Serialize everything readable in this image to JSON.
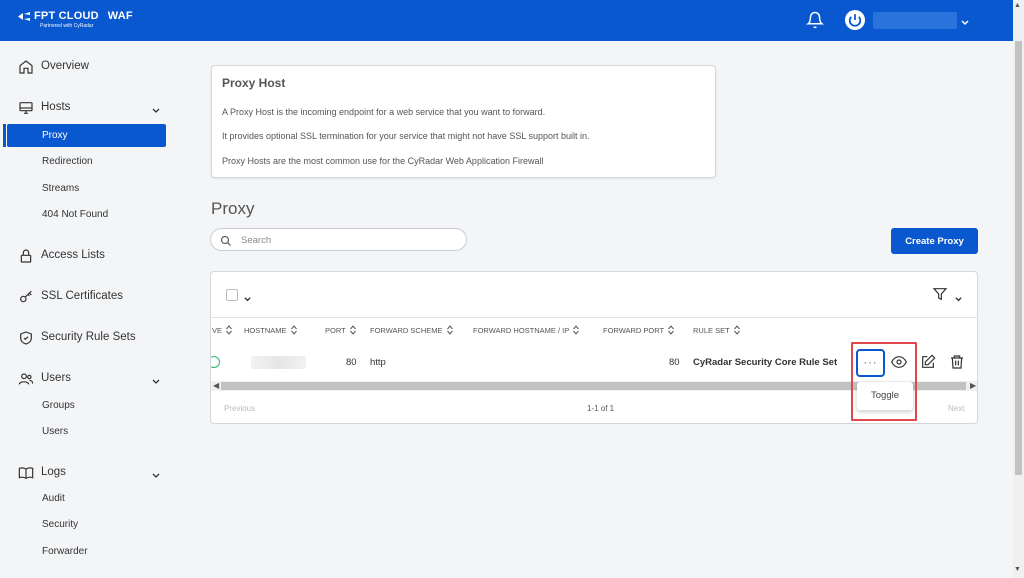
{
  "header": {
    "brand": "FPT CLOUD",
    "product": "WAF",
    "tagline": "Partnered with CyRadar"
  },
  "sidebar": {
    "groups": [
      {
        "label": "Overview",
        "icon": "home-icon"
      },
      {
        "label": "Hosts",
        "icon": "monitor-icon"
      },
      {
        "label": "Access Lists",
        "icon": "lock-icon"
      },
      {
        "label": "SSL Certificates",
        "icon": "key-icon"
      },
      {
        "label": "Security Rule Sets",
        "icon": "shield-icon"
      },
      {
        "label": "Users",
        "icon": "users-icon"
      },
      {
        "label": "Logs",
        "icon": "book-icon"
      }
    ],
    "hosts_items": [
      "Proxy",
      "Redirection",
      "Streams",
      "404 Not Found"
    ],
    "users_items": [
      "Groups",
      "Users"
    ],
    "logs_items": [
      "Audit",
      "Security",
      "Forwarder"
    ],
    "active_item": "Proxy"
  },
  "info_card": {
    "title": "Proxy Host",
    "lines": [
      "A Proxy Host is the incoming endpoint for a web service that you want to forward.",
      "It provides optional SSL termination for your service that might not have SSL support built in.",
      "Proxy Hosts are the most common use for the CyRadar Web Application Firewall"
    ]
  },
  "main": {
    "title": "Proxy",
    "search_placeholder": "Search",
    "create_button": "Create Proxy"
  },
  "table": {
    "columns": [
      "VE",
      "HOSTNAME",
      "PORT",
      "FORWARD SCHEME",
      "FORWARD HOSTNAME / IP",
      "FORWARD PORT",
      "RULE SET"
    ],
    "rows": [
      {
        "port": "80",
        "forward_scheme": "http",
        "forward_port": "80",
        "rule_set": "CyRadar Security Core Rule Set"
      }
    ],
    "pagination": {
      "prev": "Previous",
      "count": "1-1 of 1",
      "next": "Next"
    },
    "more_label": "···",
    "popover": "Toggle"
  },
  "colors": {
    "primary": "#0a58d0",
    "success": "#2db56d",
    "highlight": "#e0484b"
  }
}
